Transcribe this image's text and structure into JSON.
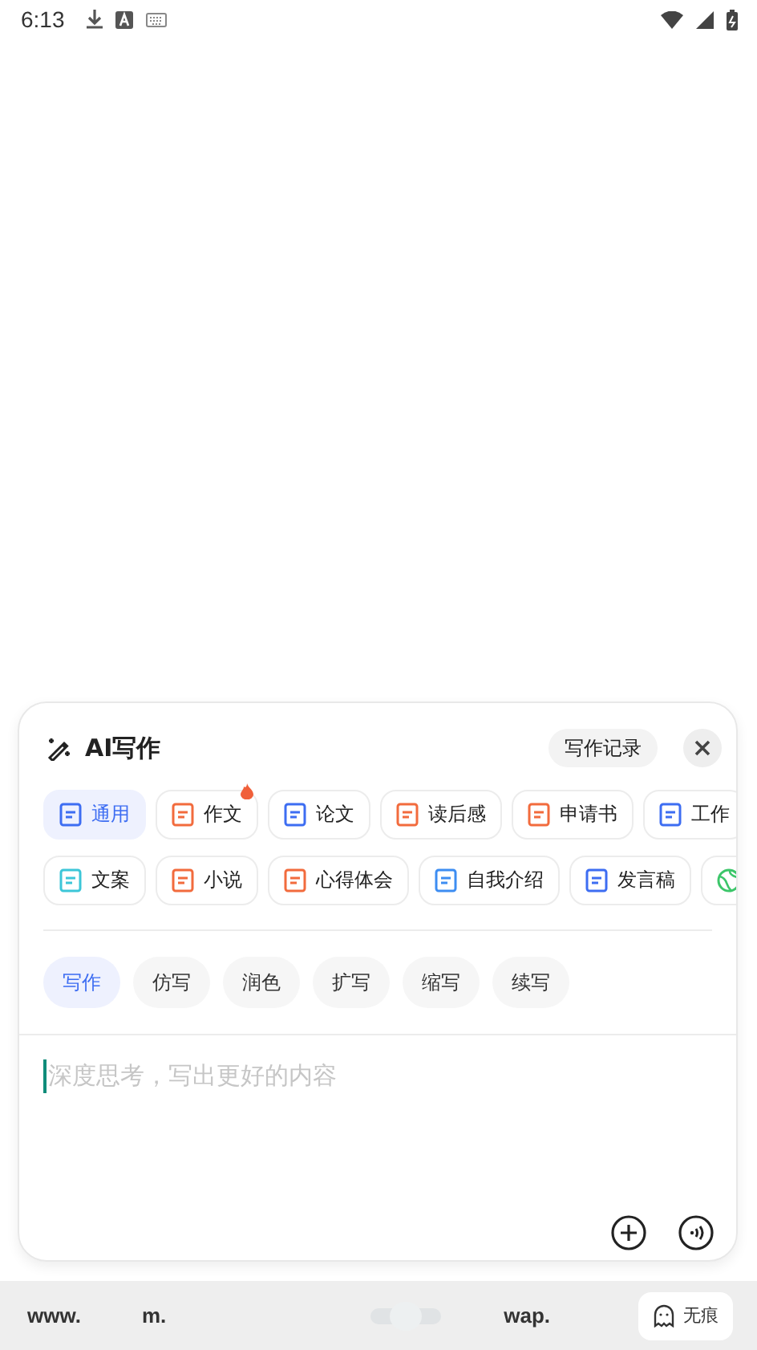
{
  "status_bar": {
    "time": "6:13"
  },
  "panel": {
    "title": "AI写作",
    "history_button": "写作记录",
    "categories": [
      {
        "label": "通用",
        "selected": true,
        "hot": false,
        "color": "#3d6df2"
      },
      {
        "label": "作文",
        "selected": false,
        "hot": true,
        "color": "#f26b3d"
      },
      {
        "label": "论文",
        "selected": false,
        "hot": false,
        "color": "#3d6df2"
      },
      {
        "label": "读后感",
        "selected": false,
        "hot": false,
        "color": "#f26b3d"
      },
      {
        "label": "申请书",
        "selected": false,
        "hot": false,
        "color": "#f26b3d"
      },
      {
        "label": "工作",
        "selected": false,
        "hot": false,
        "color": "#3d6df2"
      }
    ],
    "categories_2": [
      {
        "label": "文案",
        "selected": false,
        "hot": false,
        "color": "#3cc6d8"
      },
      {
        "label": "小说",
        "selected": false,
        "hot": false,
        "color": "#f26b3d"
      },
      {
        "label": "心得体会",
        "selected": false,
        "hot": false,
        "color": "#f26b3d"
      },
      {
        "label": "自我介绍",
        "selected": false,
        "hot": false,
        "color": "#3d8df2"
      },
      {
        "label": "发言稿",
        "selected": false,
        "hot": false,
        "color": "#3d6df2"
      },
      {
        "kind": "partial",
        "selected": false,
        "hot": false,
        "color": "#3cc66a"
      }
    ],
    "modes": [
      {
        "label": "写作",
        "selected": true
      },
      {
        "label": "仿写",
        "selected": false
      },
      {
        "label": "润色",
        "selected": false
      },
      {
        "label": "扩写",
        "selected": false
      },
      {
        "label": "缩写",
        "selected": false
      },
      {
        "label": "续写",
        "selected": false
      }
    ],
    "input": {
      "placeholder": "深度思考，写出更好的内容"
    }
  },
  "bottom_bar": {
    "items": [
      "www.",
      "m."
    ],
    "items_right": [
      "wap."
    ],
    "private_button": "无痕"
  }
}
